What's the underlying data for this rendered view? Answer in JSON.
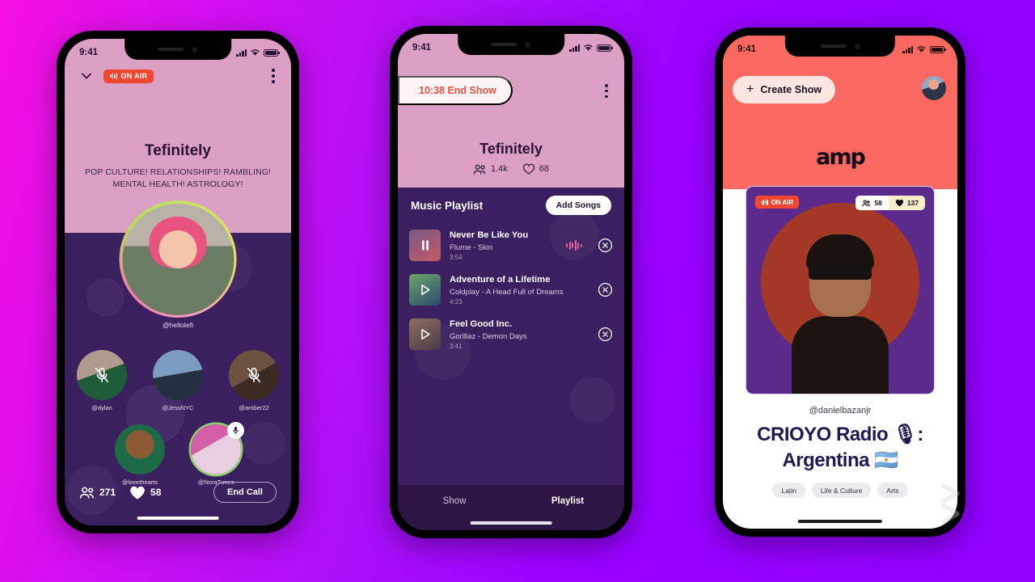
{
  "background": {
    "from": "#f50fe0",
    "to": "#8f00ff"
  },
  "phone1": {
    "status": {
      "time": "9:41"
    },
    "topbar": {
      "collapse_icon": "chevron-down-icon",
      "onair_label": "ON AIR",
      "menu_icon": "kebab-menu-icon"
    },
    "title": "Tefinitely",
    "subtitle_line1": "POP CULTURE! RELATIONSHIPS! RAMBLING!",
    "subtitle_line2": "MENTAL HEALTH! ASTROLOGY!",
    "host": {
      "handle": "@hellotefi"
    },
    "participants": [
      {
        "handle": "@dylan",
        "muted": true,
        "speaking": false
      },
      {
        "handle": "@JessNYC",
        "muted": false,
        "speaking": false
      },
      {
        "handle": "@amber22",
        "muted": true,
        "speaking": false
      },
      {
        "handle": "@lovethearts",
        "muted": false,
        "speaking": false
      },
      {
        "handle": "@NoraTunes",
        "muted": false,
        "speaking": true
      }
    ],
    "footer": {
      "listeners": "271",
      "hearts": "58",
      "end_call_label": "End Call"
    },
    "colors": {
      "pink": "#dba0c4",
      "purple": "#3b2060",
      "onair": "#f2472e"
    }
  },
  "phone2": {
    "status": {
      "time": "9:41"
    },
    "end_show_label": "10:38 End Show",
    "menu_icon": "kebab-menu-icon",
    "title": "Tefinitely",
    "stats": {
      "listeners": "1.4k",
      "hearts": "68"
    },
    "playlist_header": "Music Playlist",
    "add_songs_label": "Add Songs",
    "tracks": [
      {
        "title": "Never Be Like You",
        "artist": "Flume - Skin",
        "duration": "3:54",
        "state": "playing",
        "icon": "pause-icon"
      },
      {
        "title": "Adventure of a Lifetime",
        "artist": "Coldplay - A Head Full of Dreams",
        "duration": "4:23",
        "state": "paused",
        "icon": "play-icon"
      },
      {
        "title": "Feel Good Inc.",
        "artist": "Gorillaz - Demon Days",
        "duration": "3:41",
        "state": "paused",
        "icon": "play-icon"
      }
    ],
    "tabs": [
      {
        "label": "Show",
        "active": false
      },
      {
        "label": "Playlist",
        "active": true
      }
    ],
    "colors": {
      "pink": "#dba0c4",
      "purple": "#3a2060",
      "accent": "#e0543f"
    }
  },
  "phone3": {
    "status": {
      "time": "9:41"
    },
    "create_show_label": "Create Show",
    "profile_icon": "avatar",
    "brand": "amp",
    "card": {
      "onair_label": "ON AIR",
      "listeners": "58",
      "hearts": "137"
    },
    "handle": "@danielbazanjr",
    "show_title_line1": "CRIOYO Radio 🎙:",
    "show_title_line2": "Argentina 🇦🇷",
    "tags": [
      "Latin",
      "Life & Culture",
      "Arts"
    ],
    "colors": {
      "coral": "#f9695f",
      "card": "#5b2a8c",
      "circle": "#a43826"
    }
  }
}
